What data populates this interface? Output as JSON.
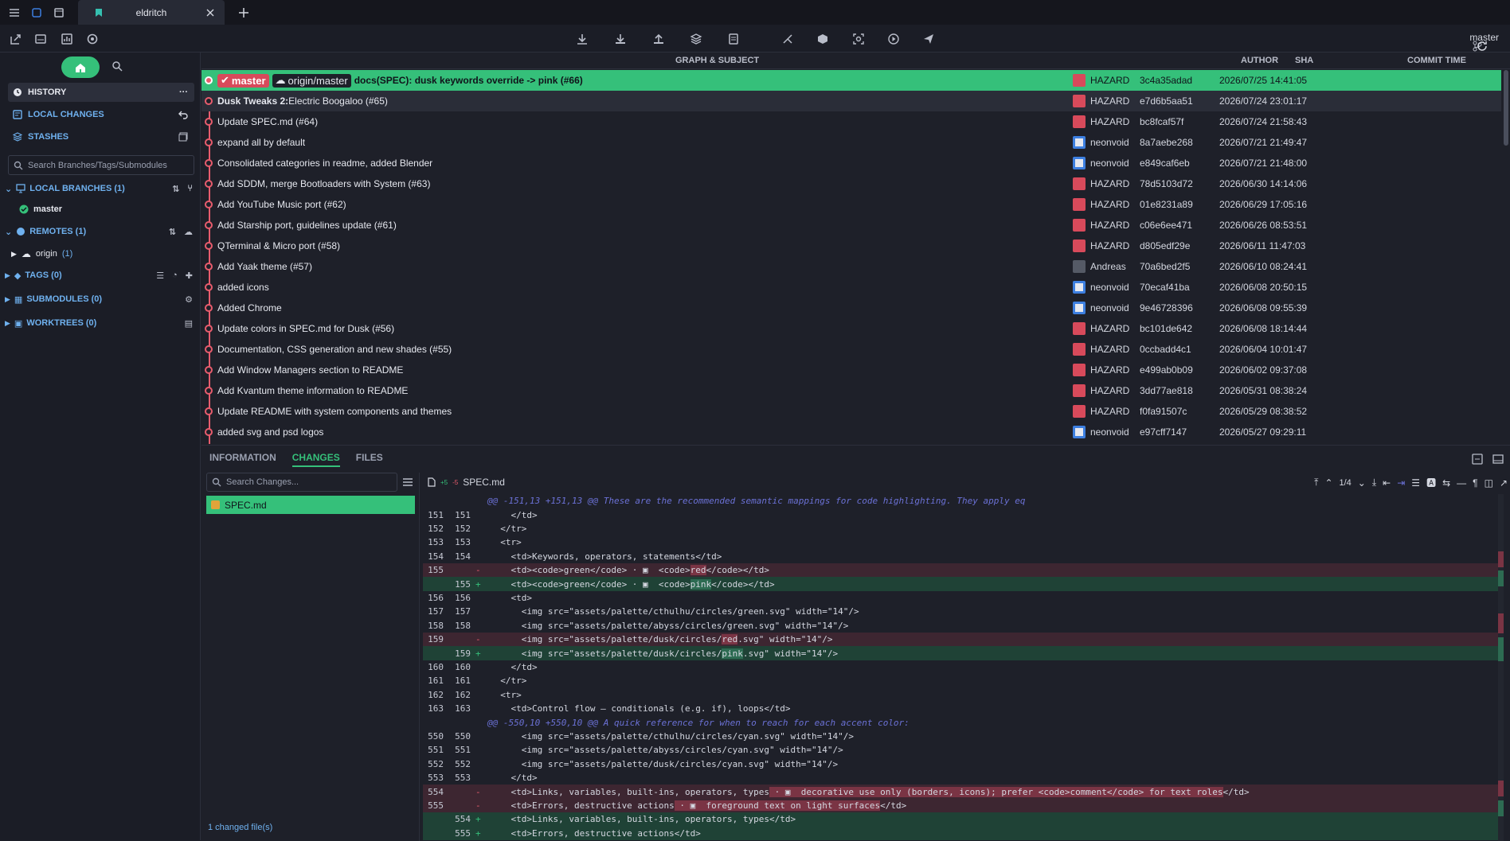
{
  "app": {
    "tab_title": "eldritch",
    "branch": "master"
  },
  "sidebar": {
    "nav": [
      {
        "label": "HISTORY",
        "active": true
      },
      {
        "label": "LOCAL CHANGES"
      },
      {
        "label": "STASHES"
      }
    ],
    "search_placeholder": "Search Branches/Tags/Submodules",
    "sections": {
      "local_branches": "LOCAL BRANCHES (1)",
      "remotes": "REMOTES (1)",
      "tags": "TAGS (0)",
      "submodules": "SUBMODULES (0)",
      "worktrees": "WORKTREES (0)"
    },
    "local_branch": "master",
    "remote": "origin",
    "remote_count": "(1)"
  },
  "commits_header": {
    "graph": "GRAPH & SUBJECT",
    "author": "AUTHOR",
    "sha": "SHA",
    "time": "COMMIT TIME"
  },
  "commits": [
    {
      "subject": "docs(SPEC): dusk keywords override -> pink (#66)",
      "author": "HAZARD",
      "sha": "3c4a35adad",
      "time": "2026/07/25 14:41:05",
      "av": "hazard"
    },
    {
      "subject": "Electric Boogaloo (#65)",
      "prefix": "Dusk Tweaks 2:",
      "author": "HAZARD",
      "sha": "e7d6b5aa51",
      "time": "2026/07/24 23:01:17",
      "av": "hazard"
    },
    {
      "subject": "Update SPEC.md (#64)",
      "author": "HAZARD",
      "sha": "bc8fcaf57f",
      "time": "2026/07/24 21:58:43",
      "av": "hazard"
    },
    {
      "subject": "expand all by default",
      "author": "neonvoid",
      "sha": "8a7aebe268",
      "time": "2026/07/21 21:49:47",
      "av": "neon"
    },
    {
      "subject": "Consolidated categories in readme, added Blender",
      "author": "neonvoid",
      "sha": "e849caf6eb",
      "time": "2026/07/21 21:48:00",
      "av": "neon"
    },
    {
      "subject": "Add SDDM, merge Bootloaders with System (#63)",
      "author": "HAZARD",
      "sha": "78d5103d72",
      "time": "2026/06/30 14:14:06",
      "av": "hazard"
    },
    {
      "subject": "Add YouTube Music port (#62)",
      "author": "HAZARD",
      "sha": "01e8231a89",
      "time": "2026/06/29 17:05:16",
      "av": "hazard"
    },
    {
      "subject": "Add Starship port, guidelines update (#61)",
      "author": "HAZARD",
      "sha": "c06e6ee471",
      "time": "2026/06/26 08:53:51",
      "av": "hazard"
    },
    {
      "subject": "QTerminal & Micro port (#58)",
      "author": "HAZARD",
      "sha": "d805edf29e",
      "time": "2026/06/11 11:47:03",
      "av": "hazard"
    },
    {
      "subject": "Add Yaak theme (#57)",
      "author": "Andreas",
      "sha": "70a6bed2f5",
      "time": "2026/06/10 08:24:41",
      "av": "andreas"
    },
    {
      "subject": "added icons",
      "author": "neonvoid",
      "sha": "70ecaf41ba",
      "time": "2026/06/08 20:50:15",
      "av": "neon"
    },
    {
      "subject": "Added Chrome",
      "author": "neonvoid",
      "sha": "9e46728396",
      "time": "2026/06/08 09:55:39",
      "av": "neon"
    },
    {
      "subject": "Update colors in SPEC.md for Dusk (#56)",
      "author": "HAZARD",
      "sha": "bc101de642",
      "time": "2026/06/08 18:14:44",
      "av": "hazard"
    },
    {
      "subject": "Documentation, CSS generation and new shades (#55)",
      "author": "HAZARD",
      "sha": "0ccbadd4c1",
      "time": "2026/06/04 10:01:47",
      "av": "hazard"
    },
    {
      "subject": "Add Window Managers section to README",
      "author": "HAZARD",
      "sha": "e499ab0b09",
      "time": "2026/06/02 09:37:08",
      "av": "hazard"
    },
    {
      "subject": "Add Kvantum theme information to README",
      "author": "HAZARD",
      "sha": "3dd77ae818",
      "time": "2026/05/31 08:38:24",
      "av": "hazard"
    },
    {
      "subject": "Update README with system components and themes",
      "author": "HAZARD",
      "sha": "f0fa91507c",
      "time": "2026/05/29 08:38:52",
      "av": "hazard"
    },
    {
      "subject": "added svg and psd logos",
      "author": "neonvoid",
      "sha": "e97cff7147",
      "time": "2026/05/27 09:29:11",
      "av": "neon"
    }
  ],
  "refs": {
    "local": "master",
    "remote": "origin/master"
  },
  "details": {
    "tabs": [
      "INFORMATION",
      "CHANGES",
      "FILES"
    ],
    "search_placeholder": "Search Changes...",
    "file": "SPEC.md",
    "changed": "1 changed file(s)",
    "diff_stat_add": "+5",
    "diff_stat_del": "-5",
    "diff_file": "SPEC.md",
    "hunk_nav": "1/4"
  },
  "diff": [
    {
      "t": "h",
      "c": "@@ -151,13 +151,13 @@ These are the recommended semantic mappings for code highlighting. They apply eq"
    },
    {
      "o": "151",
      "n": "151",
      "c": "    </td>"
    },
    {
      "o": "152",
      "n": "152",
      "c": "  </tr>"
    },
    {
      "o": "153",
      "n": "153",
      "c": "  <tr>"
    },
    {
      "o": "154",
      "n": "154",
      "c": "    <td>Keywords, operators, statements</td>"
    },
    {
      "t": "del",
      "o": "155",
      "n": "",
      "a": "    <td><code>green</code> · ▣  <code>",
      "hl": "red",
      "b": "</code></td>"
    },
    {
      "t": "add",
      "o": "",
      "n": "155",
      "a": "    <td><code>green</code> · ▣  <code>",
      "hl": "pink",
      "b": "</code></td>"
    },
    {
      "o": "156",
      "n": "156",
      "c": "    <td>"
    },
    {
      "o": "157",
      "n": "157",
      "c": "      <img src=\"assets/palette/cthulhu/circles/green.svg\" width=\"14\"/>"
    },
    {
      "o": "158",
      "n": "158",
      "c": "      <img src=\"assets/palette/abyss/circles/green.svg\" width=\"14\"/>"
    },
    {
      "t": "del",
      "o": "159",
      "n": "",
      "a": "      <img src=\"assets/palette/dusk/circles/",
      "hl": "red",
      "b": ".svg\" width=\"14\"/>"
    },
    {
      "t": "add",
      "o": "",
      "n": "159",
      "a": "      <img src=\"assets/palette/dusk/circles/",
      "hl": "pink",
      "b": ".svg\" width=\"14\"/>"
    },
    {
      "o": "160",
      "n": "160",
      "c": "    </td>"
    },
    {
      "o": "161",
      "n": "161",
      "c": "  </tr>"
    },
    {
      "o": "162",
      "n": "162",
      "c": "  <tr>"
    },
    {
      "o": "163",
      "n": "163",
      "c": "    <td>Control flow — conditionals (e.g. if), loops</td>"
    },
    {
      "t": "h",
      "c": "@@ -550,10 +550,10 @@ A quick reference for when to reach for each accent color:"
    },
    {
      "o": "550",
      "n": "550",
      "c": "      <img src=\"assets/palette/cthulhu/circles/cyan.svg\" width=\"14\"/>"
    },
    {
      "o": "551",
      "n": "551",
      "c": "      <img src=\"assets/palette/abyss/circles/cyan.svg\" width=\"14\"/>"
    },
    {
      "o": "552",
      "n": "552",
      "c": "      <img src=\"assets/palette/dusk/circles/cyan.svg\" width=\"14\"/>"
    },
    {
      "o": "553",
      "n": "553",
      "c": "    </td>"
    },
    {
      "t": "del",
      "o": "554",
      "n": "",
      "a": "    <td>Links, variables, built-ins, operators, types",
      "hl": " · ▣  decorative use only (borders, icons); prefer <code>comment</code> for text roles",
      "b": "</td>"
    },
    {
      "t": "del",
      "o": "555",
      "n": "",
      "a": "    <td>Errors, destructive actions",
      "hl": " · ▣  foreground text on light surfaces",
      "b": "</td>"
    },
    {
      "t": "add",
      "o": "",
      "n": "554",
      "a": "    <td>Links, variables, built-ins, operators, types</td>",
      "hl": "",
      "b": ""
    },
    {
      "t": "add",
      "o": "",
      "n": "555",
      "a": "    <td>Errors, destructive actions</td>",
      "hl": "",
      "b": ""
    }
  ]
}
